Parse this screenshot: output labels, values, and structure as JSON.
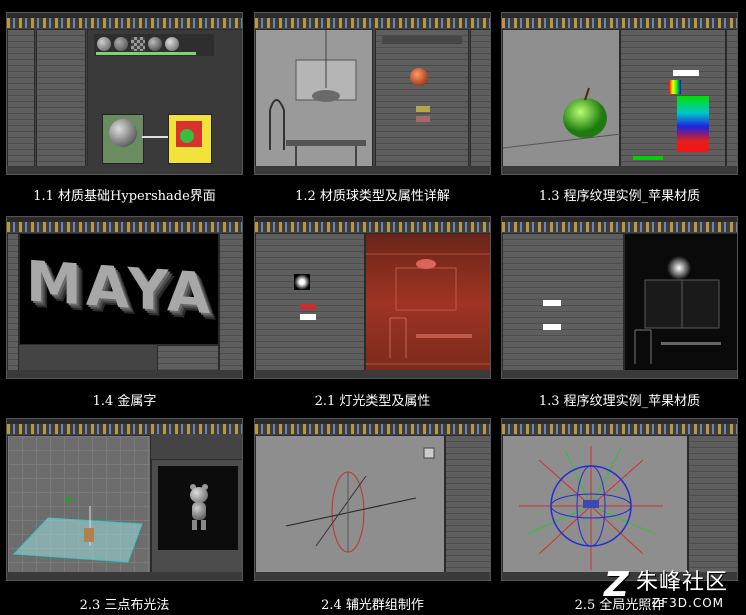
{
  "tiles": [
    {
      "caption": "1.1 材质基础Hypershade界面"
    },
    {
      "caption": "1.2 材质球类型及属性详解"
    },
    {
      "caption": "1.3 程序纹理实例_苹果材质"
    },
    {
      "caption": "1.4 金属字"
    },
    {
      "caption": "2.1 灯光类型及属性"
    },
    {
      "caption": "1.3 程序纹理实例_苹果材质"
    },
    {
      "caption": "2.3 三点布光法"
    },
    {
      "caption": "2.4 辅光群组制作"
    },
    {
      "caption": "2.5 全局光照作"
    }
  ],
  "thumbs": {
    "maya_text": "MAYA"
  },
  "watermark": {
    "logo_text": "Z",
    "brand": "朱峰社区",
    "url": "ZF3D.COM"
  }
}
